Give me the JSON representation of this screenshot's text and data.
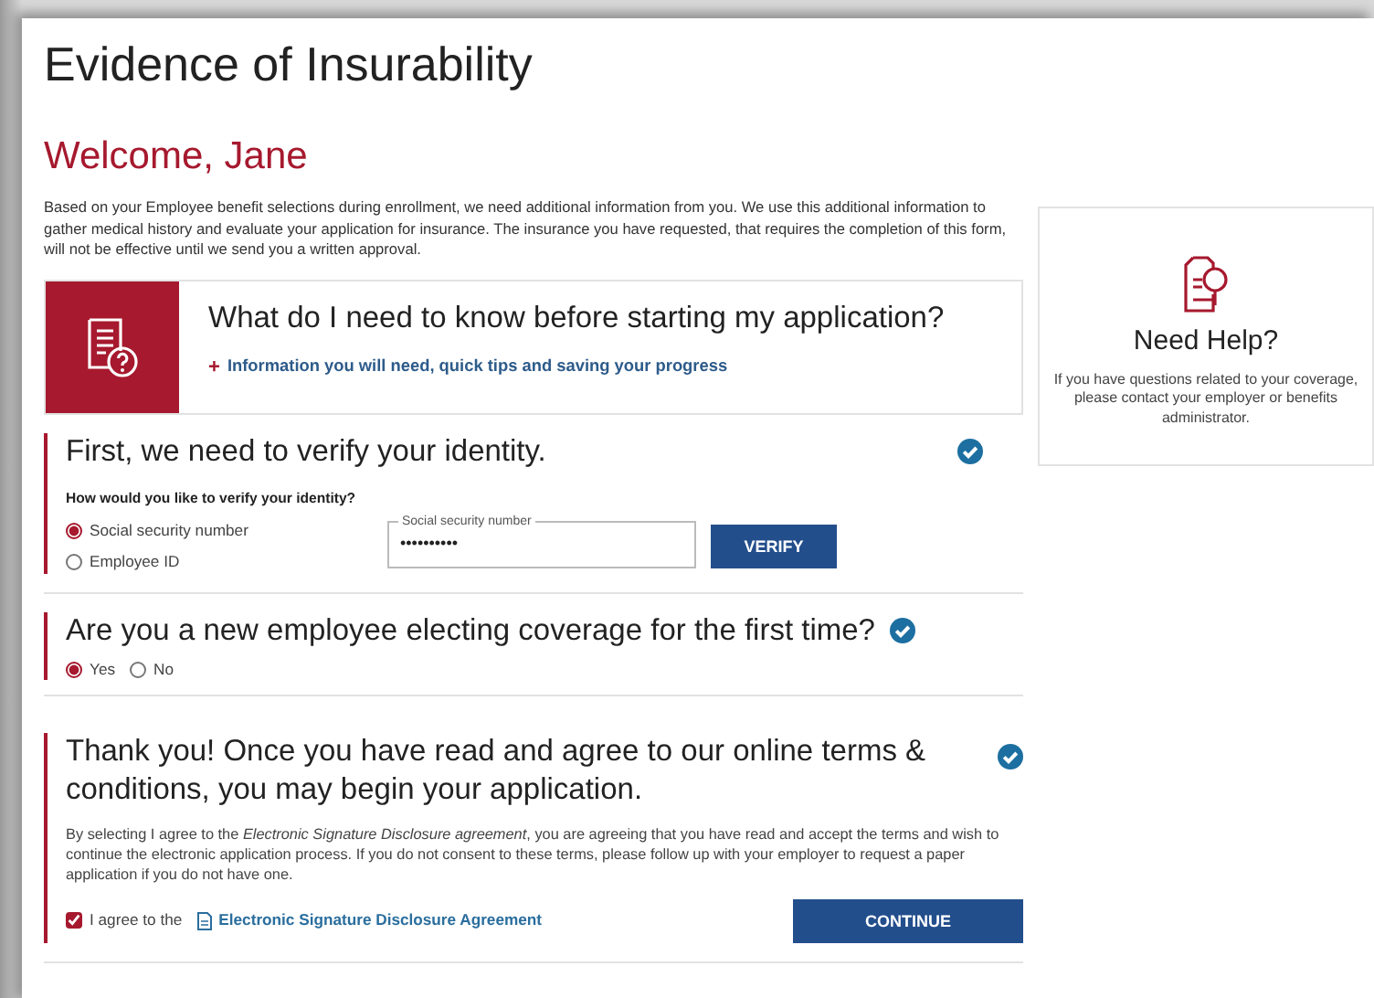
{
  "page": {
    "title": "Evidence of Insurability",
    "welcome": "Welcome, Jane",
    "intro": "Based on your Employee benefit selections during enrollment, we need additional information from you. We use this additional information to gather medical history and evaluate your application for insurance. The insurance you have requested, that requires the completion of this form, will not be effective until we send you a written approval."
  },
  "info_panel": {
    "heading": "What do I need to know before starting my application?",
    "link_icon": "+",
    "link": "Information you will need, quick tips and saving your progress"
  },
  "sections": [
    {
      "kind": "identity",
      "heading": "First, we need to verify your identity.",
      "complete": true,
      "question": "How would you like to verify your identity?",
      "options": [
        {
          "label": "Social security number",
          "selected": true
        },
        {
          "label": "Employee ID",
          "selected": false
        }
      ],
      "field": {
        "label": "Social security number",
        "value": "••••••••••"
      },
      "button": "VERIFY"
    },
    {
      "kind": "choice",
      "heading": "Are you a new employee electing coverage for the first time?",
      "complete": true,
      "options": [
        {
          "label": "Yes",
          "selected": true
        },
        {
          "label": "No",
          "selected": false
        }
      ]
    },
    {
      "kind": "terms",
      "heading": "Thank you! Once you have read and agree to our online terms & conditions, you may begin your application.",
      "complete": true,
      "text": "By selecting I agree to the *Electronic Signature Disclosure agreement*, you are agreeing that you have read and accept the terms and wish to continue the electronic application process. If you do not consent to these terms, please follow up with your employer to request a paper application if you do not have one.",
      "agree": {
        "label": "I agree to the",
        "link": "Electronic Signature Disclosure Agreement",
        "checked": true
      },
      "button": "CONTINUE"
    }
  ],
  "help": {
    "title": "Need Help?",
    "text": "If you have questions related to your coverage, please contact your employer or benefits administrator."
  }
}
